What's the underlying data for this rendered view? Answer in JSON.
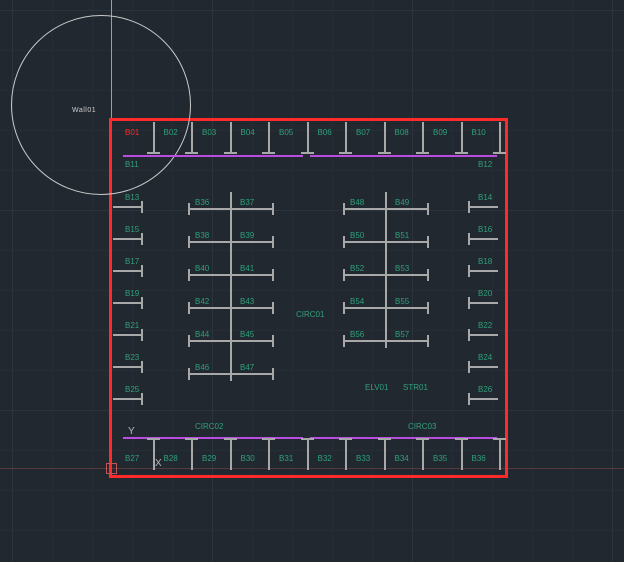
{
  "wall_label": "Wall01",
  "axes": {
    "x": "X",
    "y": "Y"
  },
  "circ_labels": {
    "c1": "CIRC01",
    "c2": "CIRC02",
    "c3": "CIRC03"
  },
  "misc_labels": {
    "elv": "ELV01",
    "str": "STR01"
  },
  "colors": {
    "border": "#ff2a2a",
    "text": "#2fa07a",
    "selected": "#ff2a2a",
    "purple": "#b84de0",
    "gray": "#a8a8a8"
  },
  "top_row": [
    "B01",
    "B02",
    "B03",
    "B04",
    "B05",
    "B06",
    "B07",
    "B08",
    "B09",
    "B10"
  ],
  "bottom_row": [
    "B27",
    "B28",
    "B29",
    "B30",
    "B31",
    "B32",
    "B33",
    "B34",
    "B35",
    "B36"
  ],
  "left_col": [
    "B11",
    "B13",
    "B15",
    "B17",
    "B19",
    "B21",
    "B23",
    "B25"
  ],
  "right_col": [
    "B12",
    "B14",
    "B16",
    "B18",
    "B20",
    "B22",
    "B24",
    "B26"
  ],
  "grp_A": [
    [
      "B36",
      "B37"
    ],
    [
      "B38",
      "B39"
    ],
    [
      "B40",
      "B41"
    ],
    [
      "B42",
      "B43"
    ],
    [
      "B44",
      "B45"
    ],
    [
      "B46",
      "B47"
    ]
  ],
  "grp_B": [
    [
      "B48",
      "B49"
    ],
    [
      "B50",
      "B51"
    ],
    [
      "B52",
      "B53"
    ],
    [
      "B54",
      "B55"
    ],
    [
      "B56",
      "B57"
    ],
    [
      "",
      ""
    ]
  ]
}
